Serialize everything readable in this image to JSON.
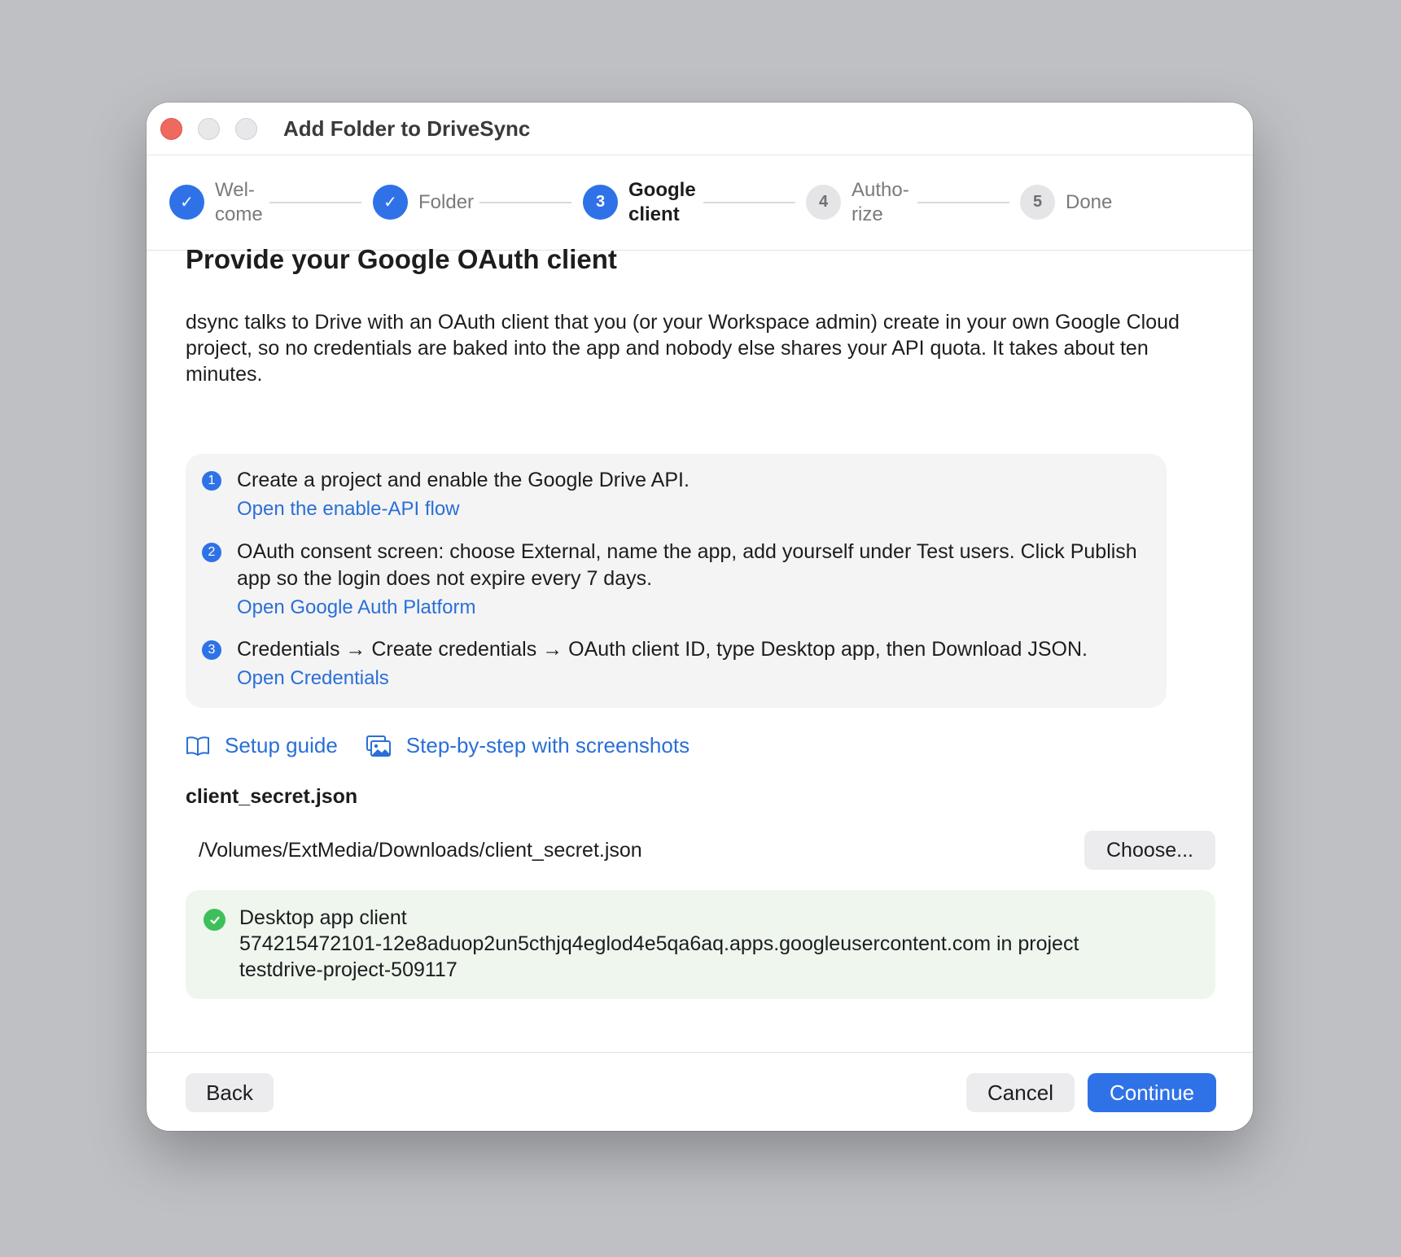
{
  "window": {
    "title": "Add Folder to DriveSync"
  },
  "stepper": {
    "steps": [
      {
        "label": "Wel-\ncome",
        "marker": "✓",
        "state": "done"
      },
      {
        "label": "Folder",
        "marker": "✓",
        "state": "done"
      },
      {
        "label": "Google\nclient",
        "marker": "3",
        "state": "current"
      },
      {
        "label": "Autho-\nrize",
        "marker": "4",
        "state": "todo"
      },
      {
        "label": "Done",
        "marker": "5",
        "state": "todo"
      }
    ]
  },
  "main": {
    "heading": "Provide your Google OAuth client",
    "intro": "dsync talks to Drive with an OAuth client that you (or your Workspace admin) create in your own Google Cloud project, so no credentials are baked into the app and nobody else shares your API quota. It takes about ten minutes.",
    "instructions": [
      {
        "num": "1",
        "text": "Create a project and enable the Google Drive API.",
        "link": "Open the enable-API flow"
      },
      {
        "num": "2",
        "text": "OAuth consent screen: choose External, name the app, add yourself under Test users. Click Publish app so the login does not expire every 7 days.",
        "link": "Open Google Auth Platform"
      },
      {
        "num": "3",
        "text": "Credentials → Create credentials → OAuth client ID, type Desktop app, then Download JSON.",
        "link": "Open Credentials"
      }
    ],
    "guides": {
      "setup_guide": "Setup guide",
      "step_by_step": "Step-by-step with screenshots"
    },
    "file": {
      "label": "client_secret.json",
      "path": "/Volumes/ExtMedia/Downloads/client_secret.json",
      "choose_label": "Choose..."
    },
    "status": {
      "text": "Desktop app client\n574215472101-12e8aduop2un5cthjq4eglod4e5qa6aq.apps.googleusercontent.com in project\ntestdrive-project-509117"
    }
  },
  "footer": {
    "back_label": "Back",
    "cancel_label": "Cancel",
    "continue_label": "Continue"
  },
  "colors": {
    "accent": "#2f72e8",
    "link": "#2a6fd6",
    "success": "#3ebf5a",
    "close_light": "#ee6a5f"
  }
}
